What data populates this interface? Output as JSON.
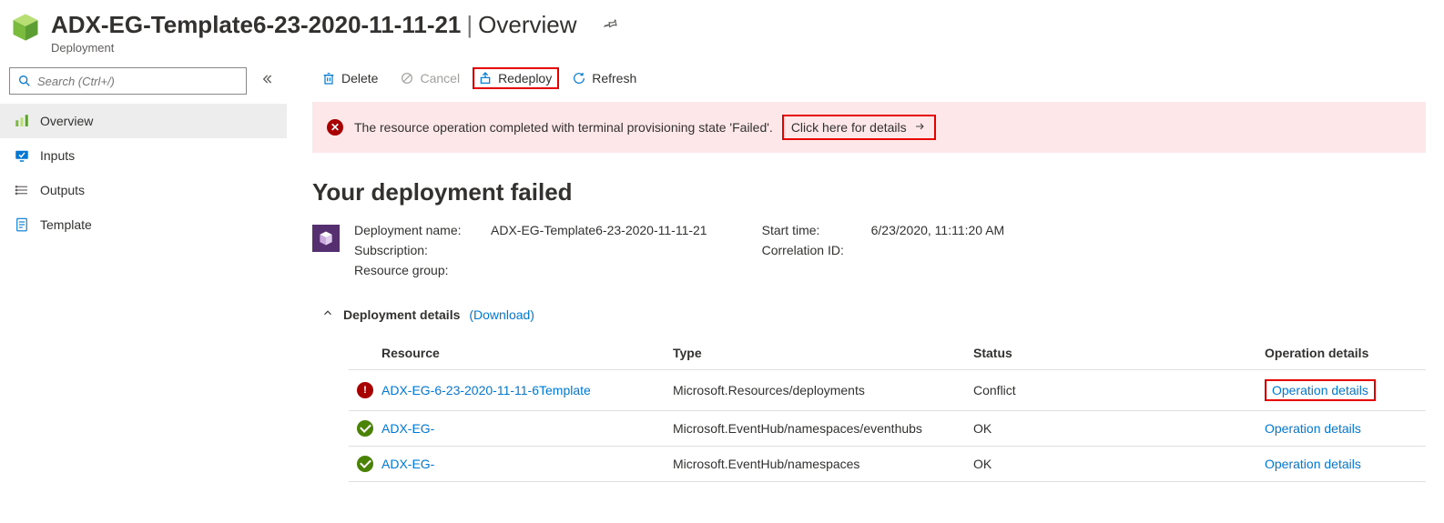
{
  "header": {
    "title": "ADX-EG-Template6-23-2020-11-11-21",
    "section": "Overview",
    "subtitle": "Deployment"
  },
  "search": {
    "placeholder": "Search (Ctrl+/)"
  },
  "nav": {
    "overview": "Overview",
    "inputs": "Inputs",
    "outputs": "Outputs",
    "template": "Template"
  },
  "toolbar": {
    "delete": "Delete",
    "cancel": "Cancel",
    "redeploy": "Redeploy",
    "refresh": "Refresh"
  },
  "alert": {
    "message": "The resource operation completed with terminal provisioning state 'Failed'.",
    "link": "Click here for details"
  },
  "page": {
    "heading": "Your deployment failed"
  },
  "summary": {
    "left": {
      "l1": "Deployment name:",
      "v1": "ADX-EG-Template6-23-2020-11-11-21",
      "l2": "Subscription:",
      "v2": "",
      "l3": "Resource group:",
      "v3": ""
    },
    "right": {
      "l1": "Start time:",
      "v1": "6/23/2020, 11:11:20 AM",
      "l2": "Correlation ID:",
      "v2": ""
    }
  },
  "details": {
    "title": "Deployment details",
    "download": "(Download)"
  },
  "table": {
    "h_resource": "Resource",
    "h_type": "Type",
    "h_status": "Status",
    "h_op": "Operation details",
    "r0": {
      "resource": "ADX-EG-6-23-2020-11-11-6Template",
      "type": "Microsoft.Resources/deployments",
      "status": "Conflict",
      "op": "Operation details"
    },
    "r1": {
      "resource": "ADX-EG-",
      "type": "Microsoft.EventHub/namespaces/eventhubs",
      "status": "OK",
      "op": "Operation details"
    },
    "r2": {
      "resource": "ADX-EG-",
      "type": "Microsoft.EventHub/namespaces",
      "status": "OK",
      "op": "Operation details"
    }
  }
}
